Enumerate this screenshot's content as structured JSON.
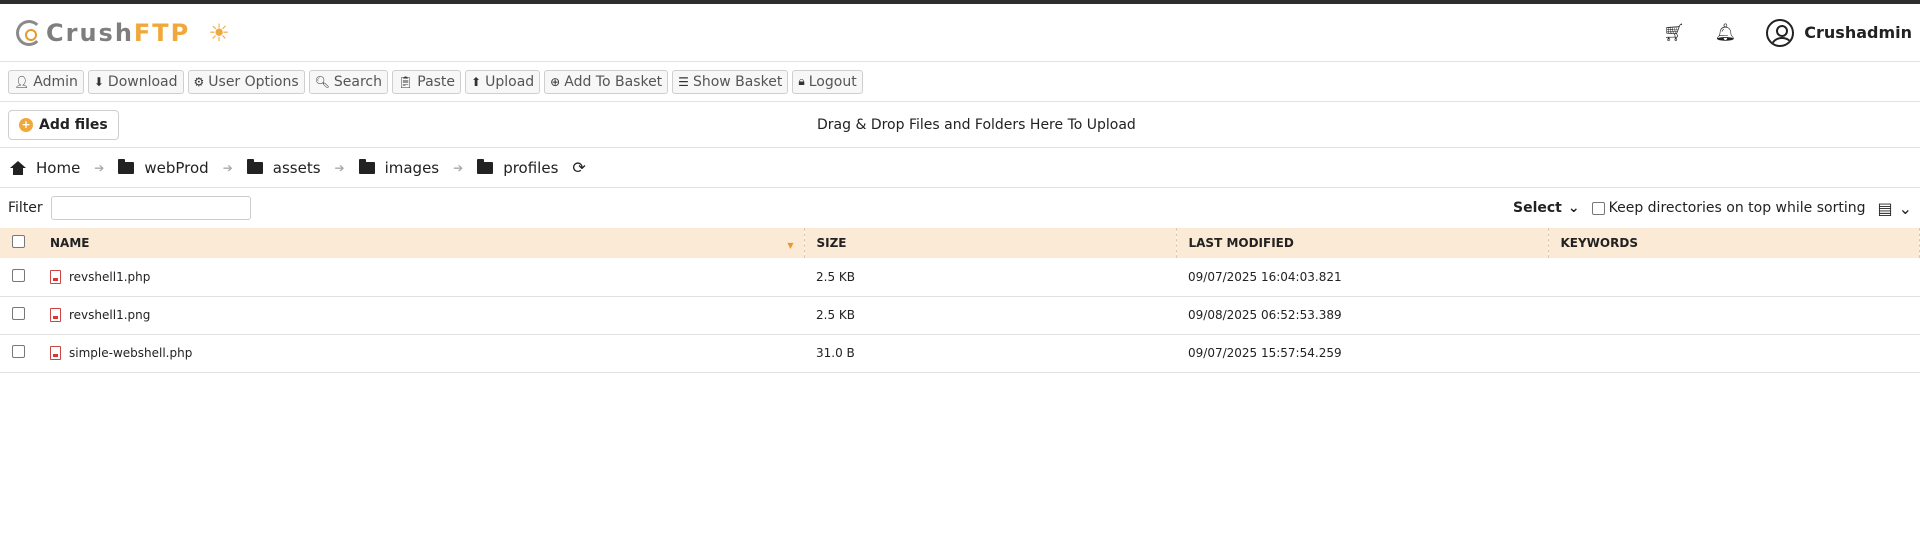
{
  "app": {
    "logo_crush": "Crush",
    "logo_ftp": "FTP",
    "theme_icon": "sun-icon",
    "username": "Crushadmin",
    "brand_color": "#f0a83a"
  },
  "toolbar": {
    "items": [
      {
        "label": "Admin",
        "icon": "user-icon"
      },
      {
        "label": "Download",
        "icon": "download-icon"
      },
      {
        "label": "User Options",
        "icon": "gear-icon"
      },
      {
        "label": "Search",
        "icon": "search-icon"
      },
      {
        "label": "Paste",
        "icon": "paste-icon"
      },
      {
        "label": "Upload",
        "icon": "upload-icon"
      },
      {
        "label": "Add To Basket",
        "icon": "plus-circle-icon"
      },
      {
        "label": "Show Basket",
        "icon": "list-icon"
      },
      {
        "label": "Logout",
        "icon": "lock-icon"
      }
    ]
  },
  "upload": {
    "add_files_label": "Add files",
    "drop_text": "Drag & Drop Files and Folders Here To Upload"
  },
  "breadcrumb": [
    "Home",
    "webProd",
    "assets",
    "images",
    "profiles"
  ],
  "filter": {
    "label": "Filter",
    "value": "",
    "select_label": "Select",
    "keep_dirs_label": "Keep directories on top while sorting"
  },
  "table": {
    "columns": [
      "NAME",
      "SIZE",
      "LAST MODIFIED",
      "KEYWORDS"
    ],
    "rows": [
      {
        "name": "revshell1.php",
        "size": "2.5 KB",
        "modified": "09/07/2025 16:04:03.821",
        "keywords": ""
      },
      {
        "name": "revshell1.png",
        "size": "2.5 KB",
        "modified": "09/08/2025 06:52:53.389",
        "keywords": ""
      },
      {
        "name": "simple-webshell.php",
        "size": "31.0 B",
        "modified": "09/07/2025 15:57:54.259",
        "keywords": ""
      }
    ]
  }
}
